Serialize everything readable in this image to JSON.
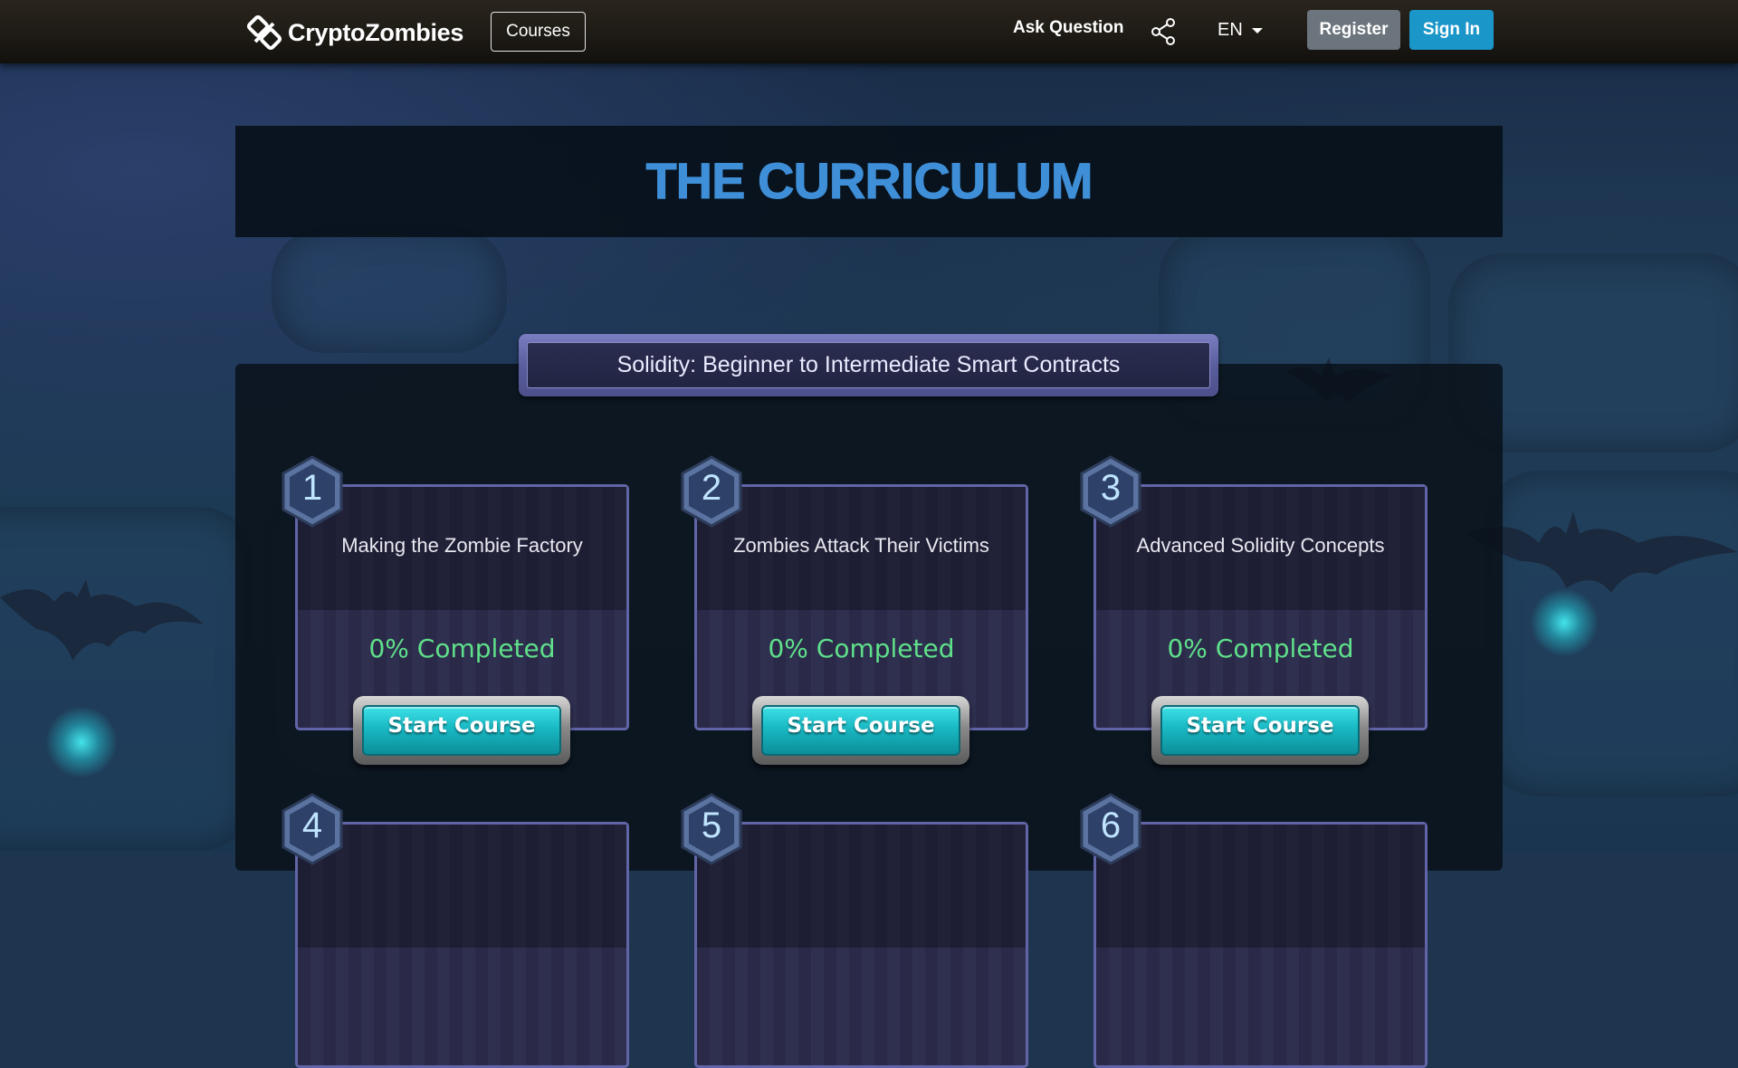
{
  "nav": {
    "brand": "CryptoZombies",
    "courses_label": "Courses",
    "ask_label": "Ask Question",
    "lang_label": "EN",
    "register_label": "Register",
    "signin_label": "Sign In"
  },
  "curriculum": {
    "title": "THE CURRICULUM",
    "course_title": "Solidity: Beginner to Intermediate Smart Contracts"
  },
  "lessons": [
    {
      "number": "1",
      "name": "Making the Zombie Factory",
      "progress": "0% Completed",
      "button": "Start Course"
    },
    {
      "number": "2",
      "name": "Zombies Attack Their Victims",
      "progress": "0% Completed",
      "button": "Start Course"
    },
    {
      "number": "3",
      "name": "Advanced Solidity Concepts",
      "progress": "0% Completed",
      "button": "Start Course"
    },
    {
      "number": "4"
    },
    {
      "number": "5"
    },
    {
      "number": "6"
    }
  ],
  "colors": {
    "title_blue": "#3f8fd8",
    "progress_green": "#5fe08a",
    "signin_blue": "#1a96c9",
    "register_gray": "#6c757d"
  }
}
